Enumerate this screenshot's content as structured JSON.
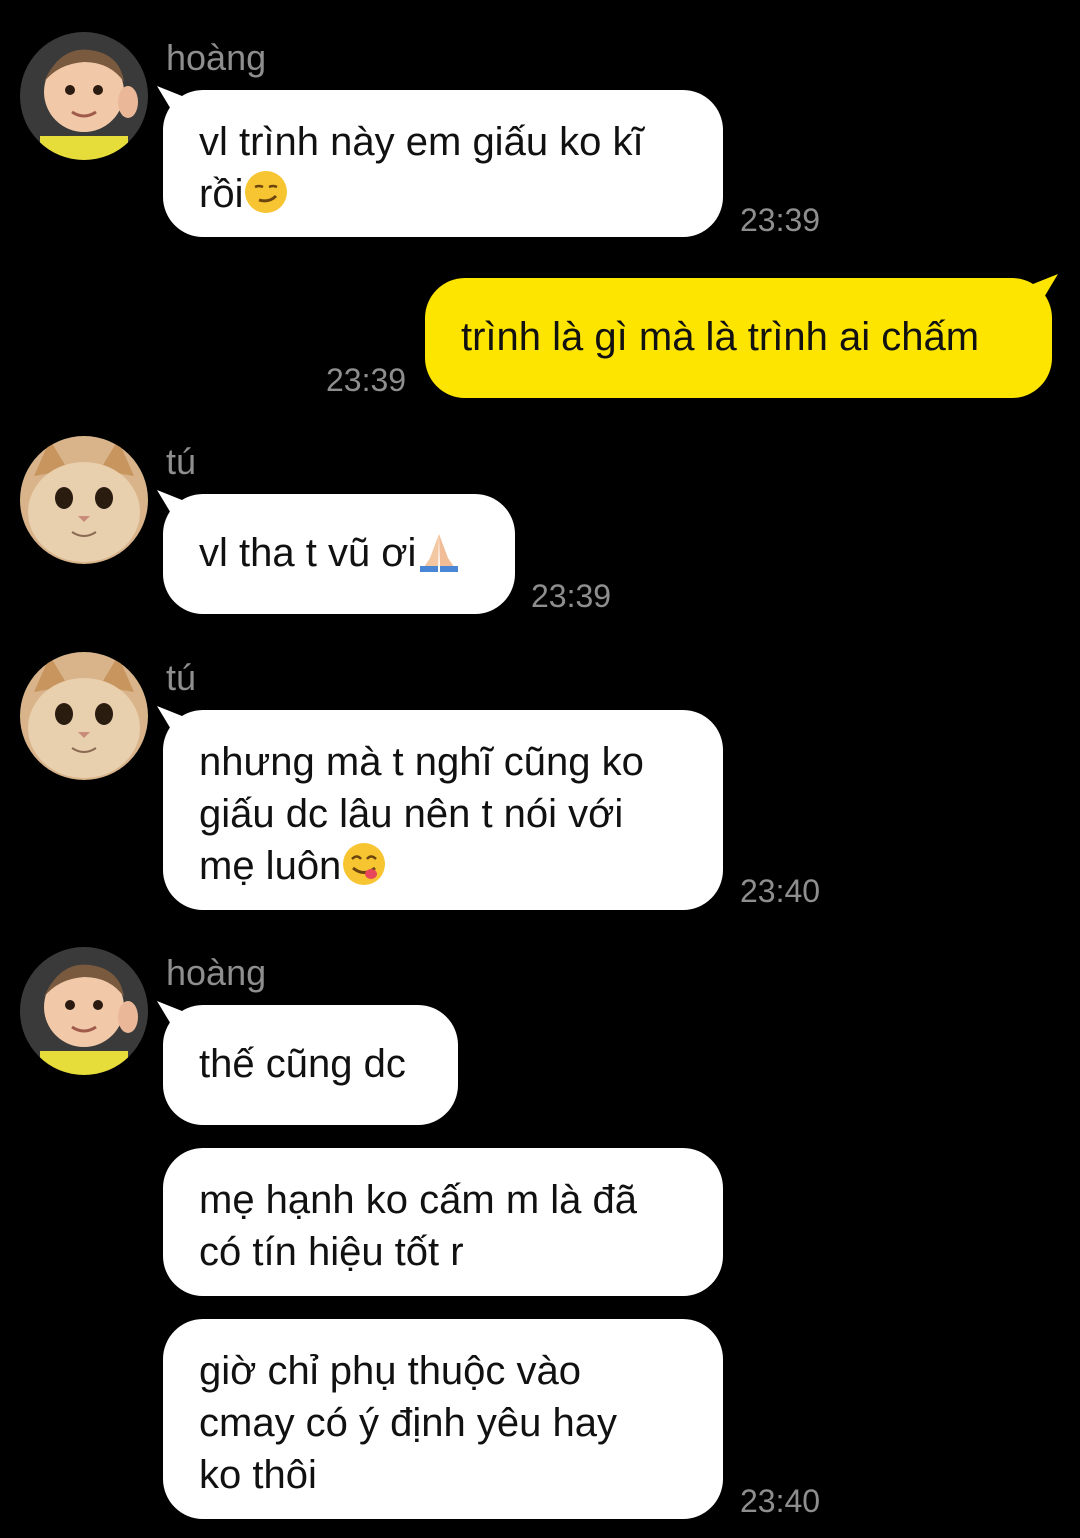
{
  "messages": [
    {
      "sender": "hoàng",
      "text": "vl trình này em giấu ko kĩ\nrồi",
      "emoji": "smirk-emoji",
      "time": "23:39"
    },
    {
      "sender": "",
      "text": "trình là gì mà là trình ai chấm",
      "time": "23:39",
      "outgoing": true
    },
    {
      "sender": "tú",
      "text": "vl tha t vũ ơi",
      "emoji": "pray-emoji",
      "time": "23:39"
    },
    {
      "sender": "tú",
      "text": "nhưng mà t nghĩ cũng ko\ngiấu dc lâu nên t nói với\nmẹ luôn",
      "emoji": "yum-emoji",
      "time": "23:40"
    },
    {
      "sender": "hoàng",
      "text": "thế cũng dc",
      "time": ""
    },
    {
      "sender": "",
      "text": "mẹ hạnh ko cấm m là đã\ncó tín hiệu tốt r",
      "time": ""
    },
    {
      "sender": "",
      "text": "giờ chỉ phụ thuộc vào\ncmay có ý định yêu hay\nko thôi",
      "time": "23:40"
    }
  ],
  "m0": {
    "sender": "hoàng",
    "line1": "vl trình này em giấu ko kĩ",
    "line2": "rồi",
    "time": "23:39"
  },
  "m1": {
    "text": "trình là gì mà là trình ai chấm",
    "time": "23:39"
  },
  "m2": {
    "sender": "tú",
    "text": "vl tha t vũ ơi",
    "time": "23:39"
  },
  "m3": {
    "sender": "tú",
    "line1": "nhưng mà t nghĩ cũng ko",
    "line2": "giấu dc lâu nên t nói với",
    "line3": "mẹ luôn",
    "time": "23:40"
  },
  "m4": {
    "sender": "hoàng",
    "text": "thế cũng dc"
  },
  "m5": {
    "line1": "mẹ hạnh ko cấm m là đã",
    "line2": "có tín hiệu tốt r"
  },
  "m6": {
    "line1": "giờ chỉ phụ thuộc vào",
    "line2": "cmay có ý định yêu hay",
    "line3": "ko thôi",
    "time": "23:40"
  },
  "colors": {
    "background": "#000000",
    "incoming_bubble": "#ffffff",
    "outgoing_bubble": "#fee500",
    "meta_text": "#8e8e8e"
  },
  "icons": {
    "avatar_hoang": "baby-avatar",
    "avatar_tu": "cat-avatar"
  }
}
